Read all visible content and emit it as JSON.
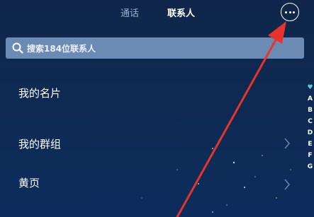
{
  "tabs": [
    {
      "label": "通话",
      "active": false
    },
    {
      "label": "联系人",
      "active": true
    }
  ],
  "more_icon": "more-icon",
  "search": {
    "placeholder": "搜索184位联系人",
    "icon": "search-icon"
  },
  "items": [
    {
      "label": "我的名片"
    },
    {
      "label": "我的群组"
    },
    {
      "label": "黄页"
    }
  ],
  "index": [
    "♥",
    "A",
    "B",
    "C",
    "D",
    "E",
    "F",
    "G"
  ],
  "colors": {
    "accent": "#6b8bb5",
    "background": "#10264a",
    "arrow": "#e8332a"
  }
}
